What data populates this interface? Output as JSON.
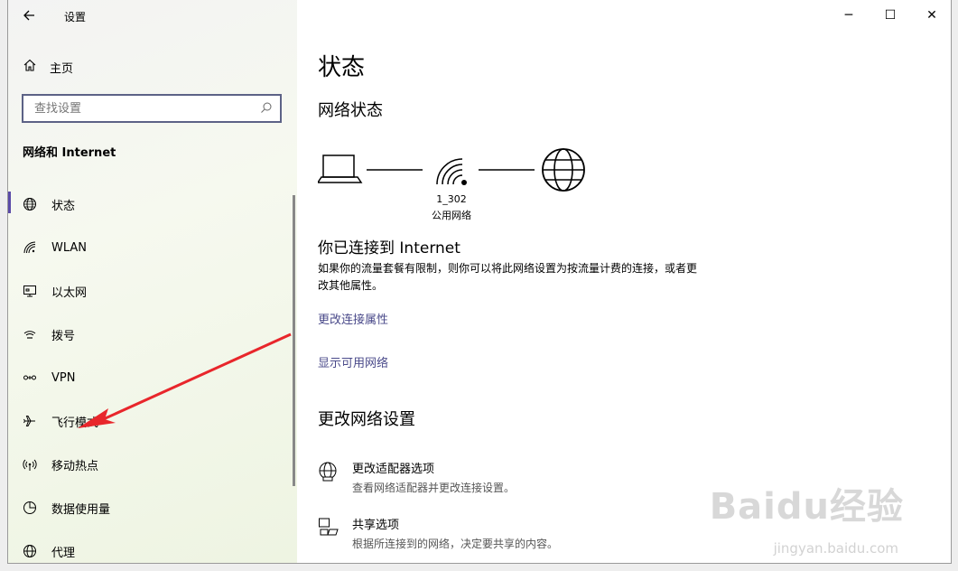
{
  "app": {
    "title": "设置"
  },
  "window_controls": {
    "minimize": "─",
    "maximize": "☐",
    "close": "✕"
  },
  "sidebar": {
    "home_label": "主页",
    "search_placeholder": "查找设置",
    "section_title": "网络和 Internet",
    "items": [
      {
        "label": "状态",
        "icon": "globe-icon"
      },
      {
        "label": "WLAN",
        "icon": "wifi-icon"
      },
      {
        "label": "以太网",
        "icon": "ethernet-icon"
      },
      {
        "label": "拨号",
        "icon": "dialup-icon"
      },
      {
        "label": "VPN",
        "icon": "vpn-icon"
      },
      {
        "label": "飞行模式",
        "icon": "airplane-icon"
      },
      {
        "label": "移动热点",
        "icon": "hotspot-icon"
      },
      {
        "label": "数据使用量",
        "icon": "data-usage-icon"
      },
      {
        "label": "代理",
        "icon": "proxy-globe-icon"
      }
    ]
  },
  "main": {
    "page_title": "状态",
    "network_status_heading": "网络状态",
    "network_name": "1_302",
    "network_type": "公用网络",
    "connected_title": "你已连接到 Internet",
    "connected_desc": "如果你的流量套餐有限制，则你可以将此网络设置为按流量计费的连接，或者更改其他属性。",
    "link_change_props": "更改连接属性",
    "link_show_networks": "显示可用网络",
    "change_settings_heading": "更改网络设置",
    "options": [
      {
        "title": "更改适配器选项",
        "subtitle": "查看网络适配器并更改连接设置。",
        "icon": "adapter-globe-icon"
      },
      {
        "title": "共享选项",
        "subtitle": "根据所连接到的网络，决定要共享的内容。",
        "icon": "sharing-icon"
      }
    ]
  },
  "watermark": {
    "logo": "Baidu经验",
    "url": "jingyan.baidu.com"
  },
  "colors": {
    "accent": "#5a4aa8",
    "link": "#4a4a8a",
    "arrow": "#e8262b"
  }
}
